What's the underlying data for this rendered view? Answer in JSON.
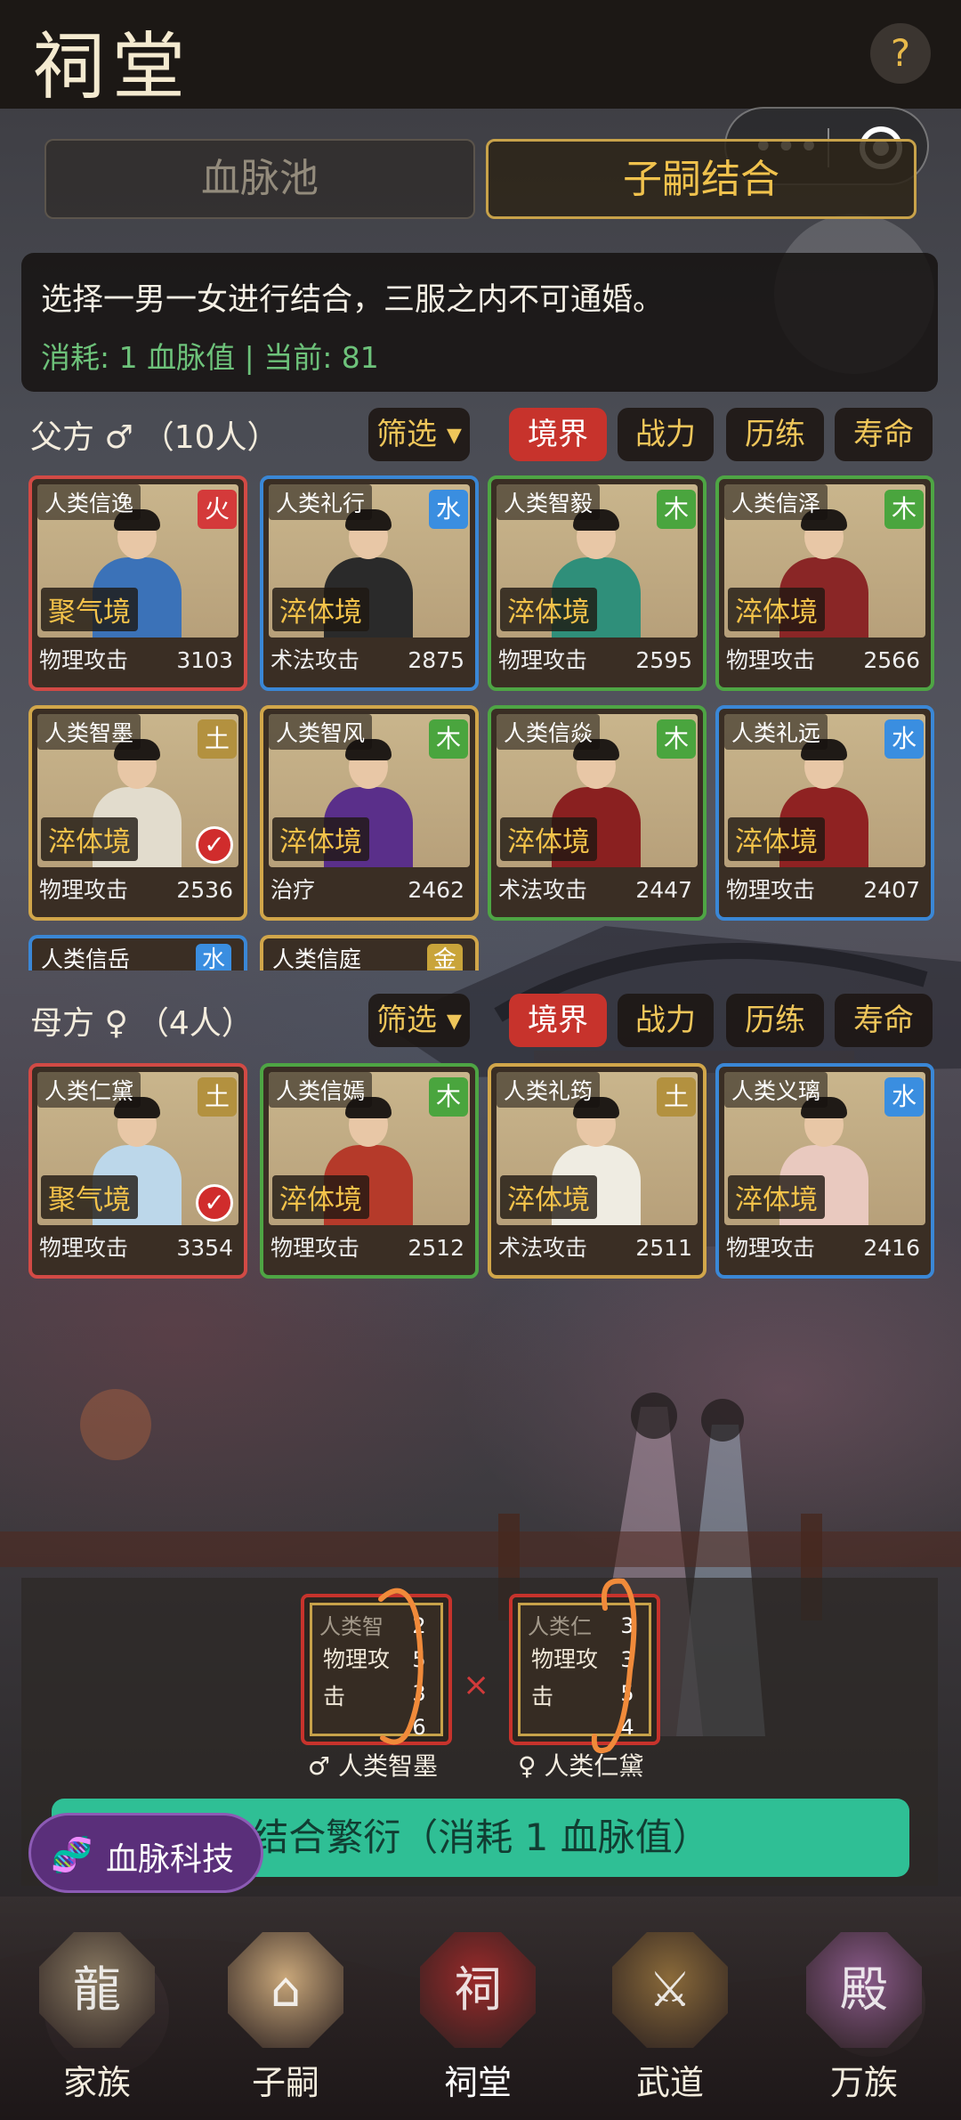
{
  "header": {
    "title": "祠堂",
    "help": "?"
  },
  "tabs": {
    "pool": "血脉池",
    "pairing": "子嗣结合"
  },
  "info": {
    "line1": "选择一男一女进行结合，三服之内不可通婚。",
    "line2": "消耗: 1 血脉值 | 当前: 81"
  },
  "sort_labels": {
    "filter": "筛选 ▾",
    "realm": "境界",
    "power": "战力",
    "experience": "历练",
    "lifespan": "寿命"
  },
  "father": {
    "title": "父方 ♂",
    "count": "（10人）",
    "cards": [
      {
        "name": "人类信逸",
        "element": "火",
        "element_color": "#d43a3a",
        "realm": "聚气境",
        "stat": "物理攻击",
        "value": "3103",
        "frame": "red",
        "selected": false,
        "robe": "#3b72b8"
      },
      {
        "name": "人类礼行",
        "element": "水",
        "element_color": "#3a8ee0",
        "realm": "淬体境",
        "stat": "术法攻击",
        "value": "2875",
        "frame": "blue",
        "selected": false,
        "robe": "#2a2a2a"
      },
      {
        "name": "人类智毅",
        "element": "木",
        "element_color": "#4aa53e",
        "realm": "淬体境",
        "stat": "物理攻击",
        "value": "2595",
        "frame": "green",
        "selected": false,
        "robe": "#2f8f7a"
      },
      {
        "name": "人类信泽",
        "element": "木",
        "element_color": "#4aa53e",
        "realm": "淬体境",
        "stat": "物理攻击",
        "value": "2566",
        "frame": "green",
        "selected": false,
        "robe": "#8a2626"
      },
      {
        "name": "人类智墨",
        "element": "土",
        "element_color": "#b3913f",
        "realm": "淬体境",
        "stat": "物理攻击",
        "value": "2536",
        "frame": "gold",
        "selected": true,
        "robe": "#e2dccd"
      },
      {
        "name": "人类智风",
        "element": "木",
        "element_color": "#4aa53e",
        "realm": "淬体境",
        "stat": "治疗",
        "value": "2462",
        "frame": "gold",
        "selected": false,
        "robe": "#5a2f8a"
      },
      {
        "name": "人类信焱",
        "element": "木",
        "element_color": "#4aa53e",
        "realm": "淬体境",
        "stat": "术法攻击",
        "value": "2447",
        "frame": "green",
        "selected": false,
        "robe": "#8a2020"
      },
      {
        "name": "人类礼远",
        "element": "水",
        "element_color": "#3a8ee0",
        "realm": "淬体境",
        "stat": "物理攻击",
        "value": "2407",
        "frame": "blue",
        "selected": false,
        "robe": "#8f2222"
      }
    ],
    "partial": [
      {
        "name": "人类信岳",
        "element": "水",
        "frame": "blue"
      },
      {
        "name": "人类信庭",
        "element": "金",
        "frame": "gold"
      }
    ]
  },
  "mother": {
    "title": "母方 ♀",
    "count": "（4人）",
    "cards": [
      {
        "name": "人类仁黛",
        "element": "土",
        "element_color": "#b3913f",
        "realm": "聚气境",
        "stat": "物理攻击",
        "value": "3354",
        "frame": "red",
        "selected": true,
        "robe": "#bcd7ea"
      },
      {
        "name": "人类信嫣",
        "element": "木",
        "element_color": "#4aa53e",
        "realm": "淬体境",
        "stat": "物理攻击",
        "value": "2512",
        "frame": "green",
        "selected": false,
        "robe": "#b53a2a"
      },
      {
        "name": "人类礼筠",
        "element": "土",
        "element_color": "#b3913f",
        "realm": "淬体境",
        "stat": "术法攻击",
        "value": "2511",
        "frame": "gold",
        "selected": false,
        "robe": "#efece2"
      },
      {
        "name": "人类义璃",
        "element": "水",
        "element_color": "#3a8ee0",
        "realm": "淬体境",
        "stat": "物理攻击",
        "value": "2416",
        "frame": "blue",
        "selected": false,
        "robe": "#e9c9bf"
      }
    ]
  },
  "pairing": {
    "male": {
      "card_name": "人类智",
      "stat_lines": [
        "物理攻",
        "击"
      ],
      "digits": [
        "2",
        "5",
        "3",
        "6"
      ],
      "label": "♂ 人类智墨"
    },
    "female": {
      "card_name": "人类仁",
      "stat_lines": [
        "物理攻",
        "击"
      ],
      "digits": [
        "3",
        "3",
        "5",
        "4"
      ],
      "label": "♀ 人类仁黛"
    },
    "cross": "×"
  },
  "breed_button": "结合繁衍（消耗 1 血脉值）",
  "tech_button": {
    "icon": "🧬",
    "label": "血脉科技"
  },
  "nav": [
    {
      "label": "家族",
      "icon": "dragon-palace-icon",
      "glyph": "龍",
      "color": "#8a7a62"
    },
    {
      "label": "子嗣",
      "icon": "cradle-icon",
      "glyph": "⌂",
      "color": "#c9a77a"
    },
    {
      "label": "祠堂",
      "icon": "ancestral-hall-icon",
      "glyph": "祠",
      "color": "#9b2a2a"
    },
    {
      "label": "武道",
      "icon": "crossed-swords-icon",
      "glyph": "⚔",
      "color": "#8a6a3a"
    },
    {
      "label": "万族",
      "icon": "clan-hall-icon",
      "glyph": "殿",
      "color": "#8a5a8a"
    }
  ]
}
